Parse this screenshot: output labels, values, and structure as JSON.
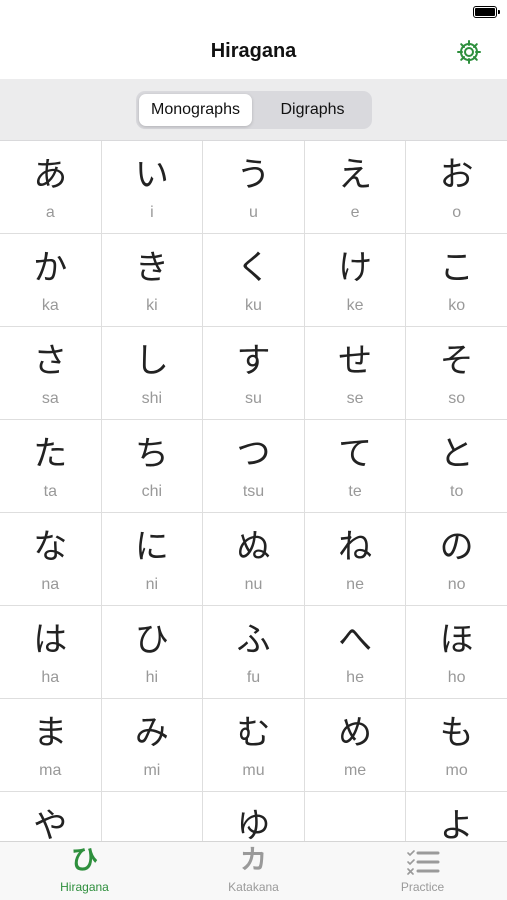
{
  "nav": {
    "title": "Hiragana"
  },
  "segments": {
    "left": "Monographs",
    "right": "Digraphs",
    "selected": "Monographs"
  },
  "grid": [
    [
      {
        "kana": "あ",
        "romaji": "a"
      },
      {
        "kana": "い",
        "romaji": "i"
      },
      {
        "kana": "う",
        "romaji": "u"
      },
      {
        "kana": "え",
        "romaji": "e"
      },
      {
        "kana": "お",
        "romaji": "o"
      }
    ],
    [
      {
        "kana": "か",
        "romaji": "ka"
      },
      {
        "kana": "き",
        "romaji": "ki"
      },
      {
        "kana": "く",
        "romaji": "ku"
      },
      {
        "kana": "け",
        "romaji": "ke"
      },
      {
        "kana": "こ",
        "romaji": "ko"
      }
    ],
    [
      {
        "kana": "さ",
        "romaji": "sa"
      },
      {
        "kana": "し",
        "romaji": "shi"
      },
      {
        "kana": "す",
        "romaji": "su"
      },
      {
        "kana": "せ",
        "romaji": "se"
      },
      {
        "kana": "そ",
        "romaji": "so"
      }
    ],
    [
      {
        "kana": "た",
        "romaji": "ta"
      },
      {
        "kana": "ち",
        "romaji": "chi"
      },
      {
        "kana": "つ",
        "romaji": "tsu"
      },
      {
        "kana": "て",
        "romaji": "te"
      },
      {
        "kana": "と",
        "romaji": "to"
      }
    ],
    [
      {
        "kana": "な",
        "romaji": "na"
      },
      {
        "kana": "に",
        "romaji": "ni"
      },
      {
        "kana": "ぬ",
        "romaji": "nu"
      },
      {
        "kana": "ね",
        "romaji": "ne"
      },
      {
        "kana": "の",
        "romaji": "no"
      }
    ],
    [
      {
        "kana": "は",
        "romaji": "ha"
      },
      {
        "kana": "ひ",
        "romaji": "hi"
      },
      {
        "kana": "ふ",
        "romaji": "fu"
      },
      {
        "kana": "へ",
        "romaji": "he"
      },
      {
        "kana": "ほ",
        "romaji": "ho"
      }
    ],
    [
      {
        "kana": "ま",
        "romaji": "ma"
      },
      {
        "kana": "み",
        "romaji": "mi"
      },
      {
        "kana": "む",
        "romaji": "mu"
      },
      {
        "kana": "め",
        "romaji": "me"
      },
      {
        "kana": "も",
        "romaji": "mo"
      }
    ],
    [
      {
        "kana": "や",
        "romaji": ""
      },
      {
        "kana": "",
        "romaji": ""
      },
      {
        "kana": "ゆ",
        "romaji": ""
      },
      {
        "kana": "",
        "romaji": ""
      },
      {
        "kana": "よ",
        "romaji": ""
      }
    ]
  ],
  "tabs": [
    {
      "label": "Hiragana",
      "glyph": "ひ",
      "icon": "hiragana-tab-icon",
      "active": true
    },
    {
      "label": "Katakana",
      "glyph": "カ",
      "icon": "katakana-tab-icon",
      "active": false
    },
    {
      "label": "Practice",
      "glyph": "",
      "icon": "checklist-icon",
      "active": false
    }
  ],
  "colors": {
    "accent": "#2e8f3d",
    "inactive": "#9a9a9a",
    "segment_bg": "#ececed"
  },
  "icons": {
    "settings": "gear-icon",
    "battery": "battery-icon"
  }
}
